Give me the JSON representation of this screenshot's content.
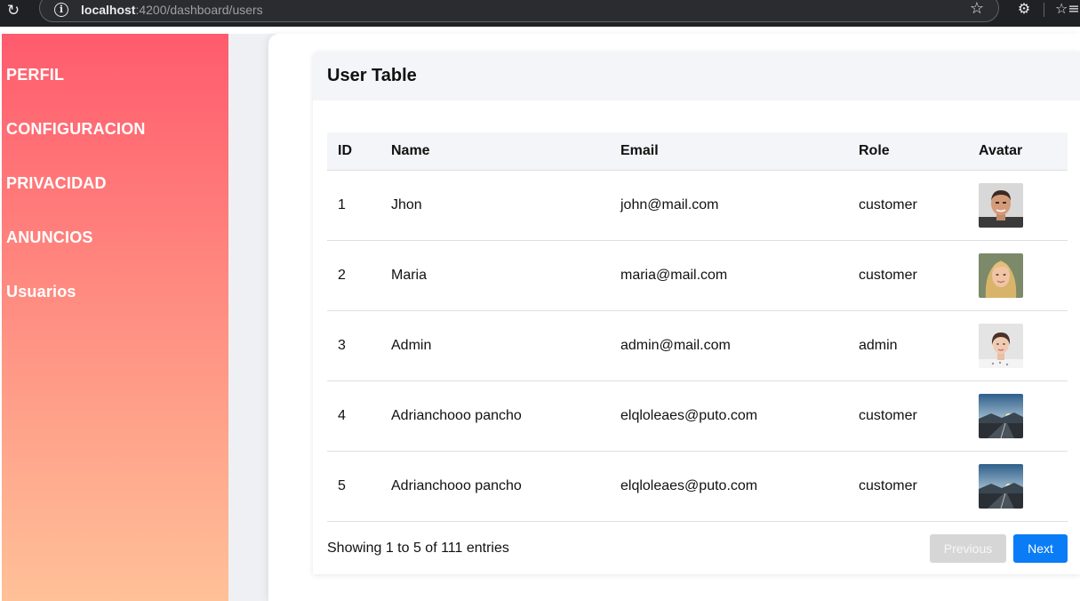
{
  "browser": {
    "url_host": "localhost",
    "url_path": ":4200/dashboard/users",
    "reload_glyph": "↻",
    "star_glyph": "☆",
    "ext_glyph": "⚙",
    "fav_glyph": "☆≡"
  },
  "sidebar": {
    "items": [
      {
        "label": "PERFIL"
      },
      {
        "label": "CONFIGURACION"
      },
      {
        "label": "PRIVACIDAD"
      },
      {
        "label": "ANUNCIOS"
      },
      {
        "label": "Usuarios"
      }
    ]
  },
  "card": {
    "title": "User Table"
  },
  "table": {
    "headers": [
      "ID",
      "Name",
      "Email",
      "Role",
      "Avatar"
    ],
    "rows": [
      {
        "id": "1",
        "name": "Jhon",
        "email": "john@mail.com",
        "role": "customer",
        "avatar": "man-portrait"
      },
      {
        "id": "2",
        "name": "Maria",
        "email": "maria@mail.com",
        "role": "customer",
        "avatar": "blonde-woman-portrait"
      },
      {
        "id": "3",
        "name": "Admin",
        "email": "admin@mail.com",
        "role": "admin",
        "avatar": "woman-portrait"
      },
      {
        "id": "4",
        "name": "Adrianchooo pancho",
        "email": "elqloleaes@puto.com",
        "role": "customer",
        "avatar": "road-landscape"
      },
      {
        "id": "5",
        "name": "Adrianchooo pancho",
        "email": "elqloleaes@puto.com",
        "role": "customer",
        "avatar": "road-landscape"
      }
    ]
  },
  "pagination": {
    "summary": "Showing 1 to 5 of 111 entries",
    "previous_label": "Previous",
    "next_label": "Next"
  },
  "colors": {
    "sidebar_top": "#ff5b6d",
    "sidebar_bottom": "#ffc198",
    "next_button": "#0a7cf6",
    "previous_button_disabled": "#d6d6d6"
  }
}
